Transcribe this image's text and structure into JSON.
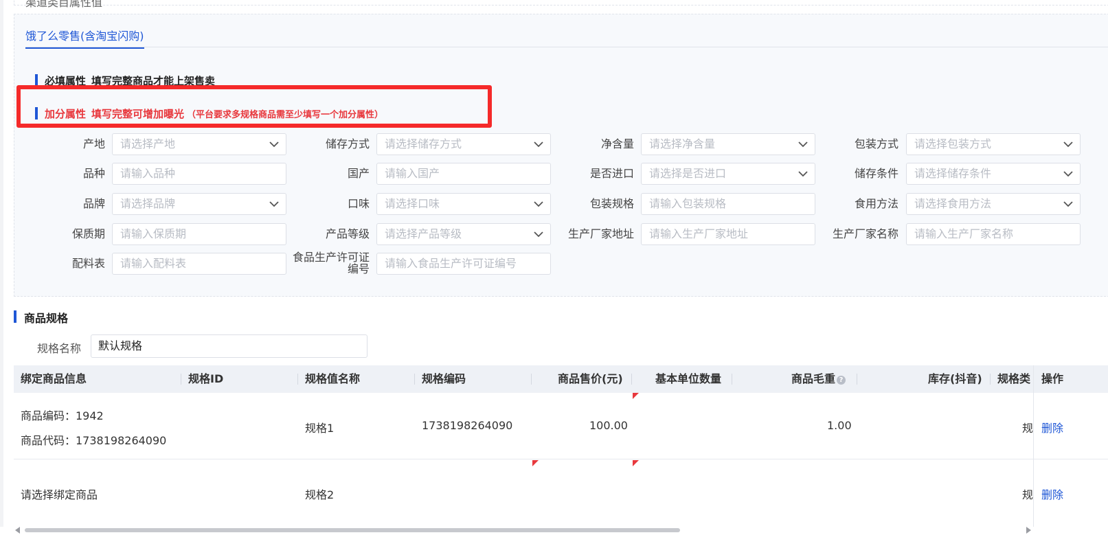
{
  "top_label": "渠道类目属性值",
  "tab": {
    "label": "饿了么零售(含淘宝闪购)"
  },
  "required_section": {
    "title": "必填属性",
    "subtitle": "填写完整商品才能上架售卖"
  },
  "bonus_section": {
    "title": "加分属性",
    "subtitle": "填写完整可增加曝光",
    "note": "（平台要求多规格商品需至少填写一个加分属性）"
  },
  "fields": [
    {
      "label": "产地",
      "placeholder": "请选择产地",
      "type": "select"
    },
    {
      "label": "储存方式",
      "placeholder": "请选择储存方式",
      "type": "select"
    },
    {
      "label": "净含量",
      "placeholder": "请选择净含量",
      "type": "select"
    },
    {
      "label": "包装方式",
      "placeholder": "请选择包装方式",
      "type": "select"
    },
    {
      "label": "品种",
      "placeholder": "请输入品种",
      "type": "input"
    },
    {
      "label": "国产",
      "placeholder": "请输入国产",
      "type": "input"
    },
    {
      "label": "是否进口",
      "placeholder": "请选择是否进口",
      "type": "select"
    },
    {
      "label": "储存条件",
      "placeholder": "请选择储存条件",
      "type": "select"
    },
    {
      "label": "品牌",
      "placeholder": "请选择品牌",
      "type": "select"
    },
    {
      "label": "口味",
      "placeholder": "请选择口味",
      "type": "select"
    },
    {
      "label": "包装规格",
      "placeholder": "请输入包装规格",
      "type": "input"
    },
    {
      "label": "食用方法",
      "placeholder": "请选择食用方法",
      "type": "select"
    },
    {
      "label": "保质期",
      "placeholder": "请输入保质期",
      "type": "input"
    },
    {
      "label": "产品等级",
      "placeholder": "请选择产品等级",
      "type": "select"
    },
    {
      "label": "生产厂家地址",
      "placeholder": "请输入生产厂家地址",
      "type": "input"
    },
    {
      "label": "生产厂家名称",
      "placeholder": "请输入生产厂家名称",
      "type": "input"
    },
    {
      "label": "配料表",
      "placeholder": "请输入配料表",
      "type": "input"
    },
    {
      "label": "食品生产许可证编号",
      "placeholder": "请输入食品生产许可证编号",
      "type": "input"
    }
  ],
  "spec": {
    "title": "商品规格",
    "name_label": "规格名称",
    "name_value": "默认规格",
    "columns": [
      "绑定商品信息",
      "规格ID",
      "规格值名称",
      "规格编码",
      "商品售价(元)",
      "基本单位数量",
      "商品毛重",
      "库存(抖音)",
      "规格类",
      "操作"
    ],
    "rows": [
      {
        "bind_line1": "商品编码：1942",
        "bind_line2": "商品代码：1738198264090",
        "spec_id": "",
        "value_name": "规格1",
        "code": "1738198264090",
        "price": "100.00",
        "unit_qty": "",
        "weight": "1.00",
        "stock": "",
        "spec_type": "规",
        "action": "删除"
      },
      {
        "bind_line1": "请选择绑定商品",
        "bind_line2": "",
        "spec_id": "",
        "value_name": "规格2",
        "code": "",
        "price": "",
        "unit_qty": "",
        "weight": "",
        "stock": "",
        "spec_type": "规",
        "action": "删除"
      }
    ]
  },
  "colors": {
    "primary": "#1f57d6",
    "danger": "#e8383d",
    "highlight": "#f52a2a"
  }
}
